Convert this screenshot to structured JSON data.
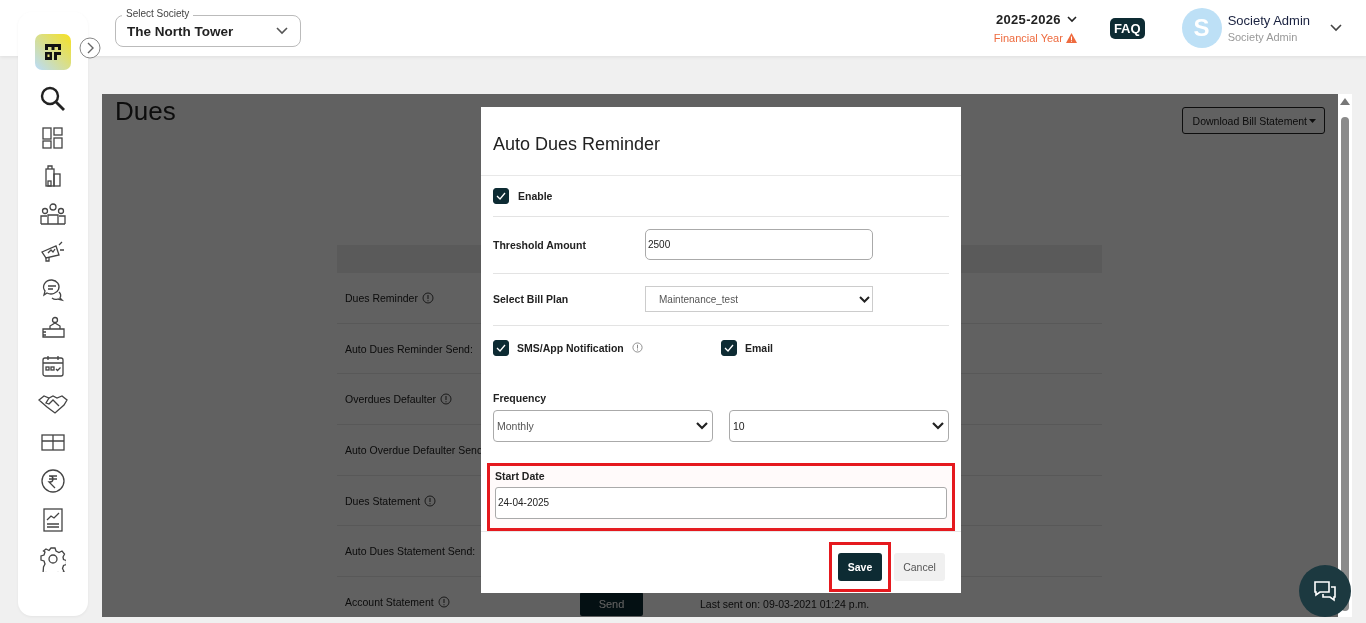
{
  "header": {
    "society_select": {
      "label": "Select Society",
      "value": "The North Tower"
    },
    "financial_year": {
      "value": "2025-2026",
      "label": "Financial Year",
      "warning": true
    },
    "faq": "FAQ",
    "user": {
      "initial": "S",
      "name": "Society Admin",
      "role": "Society Admin"
    }
  },
  "page": {
    "title": "Dues",
    "download_button": "Download Bill Statement",
    "rows": [
      {
        "label": "Dues Reminder",
        "info": true
      },
      {
        "label": "Auto Dues Reminder Send:"
      },
      {
        "label": "Overdues Defaulter",
        "info": true
      },
      {
        "label": "Auto Overdue Defaulter Send"
      },
      {
        "label": "Dues Statement",
        "info": true
      },
      {
        "label": "Auto Dues Statement Send:"
      },
      {
        "label": "Account Statement",
        "info": true,
        "button": "Send",
        "last_sent": "Last sent on: 09-03-2021 01:24 p.m."
      }
    ]
  },
  "modal": {
    "title": "Auto Dues Reminder",
    "enable": {
      "label": "Enable",
      "checked": true
    },
    "threshold": {
      "label": "Threshold Amount",
      "value": "2500"
    },
    "bill_plan": {
      "label": "Select Bill Plan",
      "value": "Maintenance_test"
    },
    "notifications": [
      {
        "label": "SMS/App Notification",
        "checked": true,
        "info": true
      },
      {
        "label": "Email",
        "checked": true
      }
    ],
    "frequency": {
      "label": "Frequency",
      "period": "Monthly",
      "day": "10"
    },
    "start_date": {
      "label": "Start Date",
      "value": "24-04-2025",
      "highlighted": true
    },
    "buttons": [
      {
        "label": "Save",
        "kind": "primary",
        "highlighted": true
      },
      {
        "label": "Cancel",
        "kind": "secondary",
        "highlighted": false
      }
    ]
  }
}
